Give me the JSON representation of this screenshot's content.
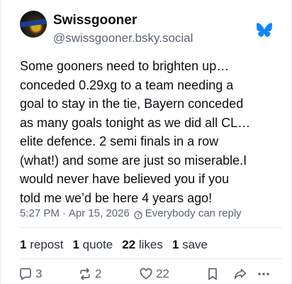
{
  "author": {
    "display_name": "Swissgooner",
    "handle": "@swissgooner.bsky.social",
    "avatar_icon": "avatar-image",
    "avatar_colors": [
      "#1a1a1a",
      "#d4a41a",
      "#1c3f8f"
    ]
  },
  "platform_icon": "bluesky-butterfly-icon",
  "brand_color": "#1185fe",
  "post": {
    "text": "Some gooners need to brighten up…\nconceded 0.29xg to a team needing a\ngoal to stay in the tie, Bayern conceded\nas many goals tonight as we did all CL…\nelite defence. 2 semi finals in a row\n(what!) and some are just so miserable.I\nwould never have believed you if you\ntold me we’d be here 4 years ago!",
    "time": "5:27 PM",
    "separator": "·",
    "date": "Apr 15, 2026",
    "reply_setting": "Everybody can reply"
  },
  "stats": {
    "reposts_count": "1",
    "reposts_label": "repost",
    "quotes_count": "1",
    "quotes_label": "quote",
    "likes_count": "22",
    "likes_label": "likes",
    "saves_count": "1",
    "saves_label": "save"
  },
  "actions": {
    "reply_count": "3",
    "repost_count": "2",
    "like_count": "22"
  }
}
